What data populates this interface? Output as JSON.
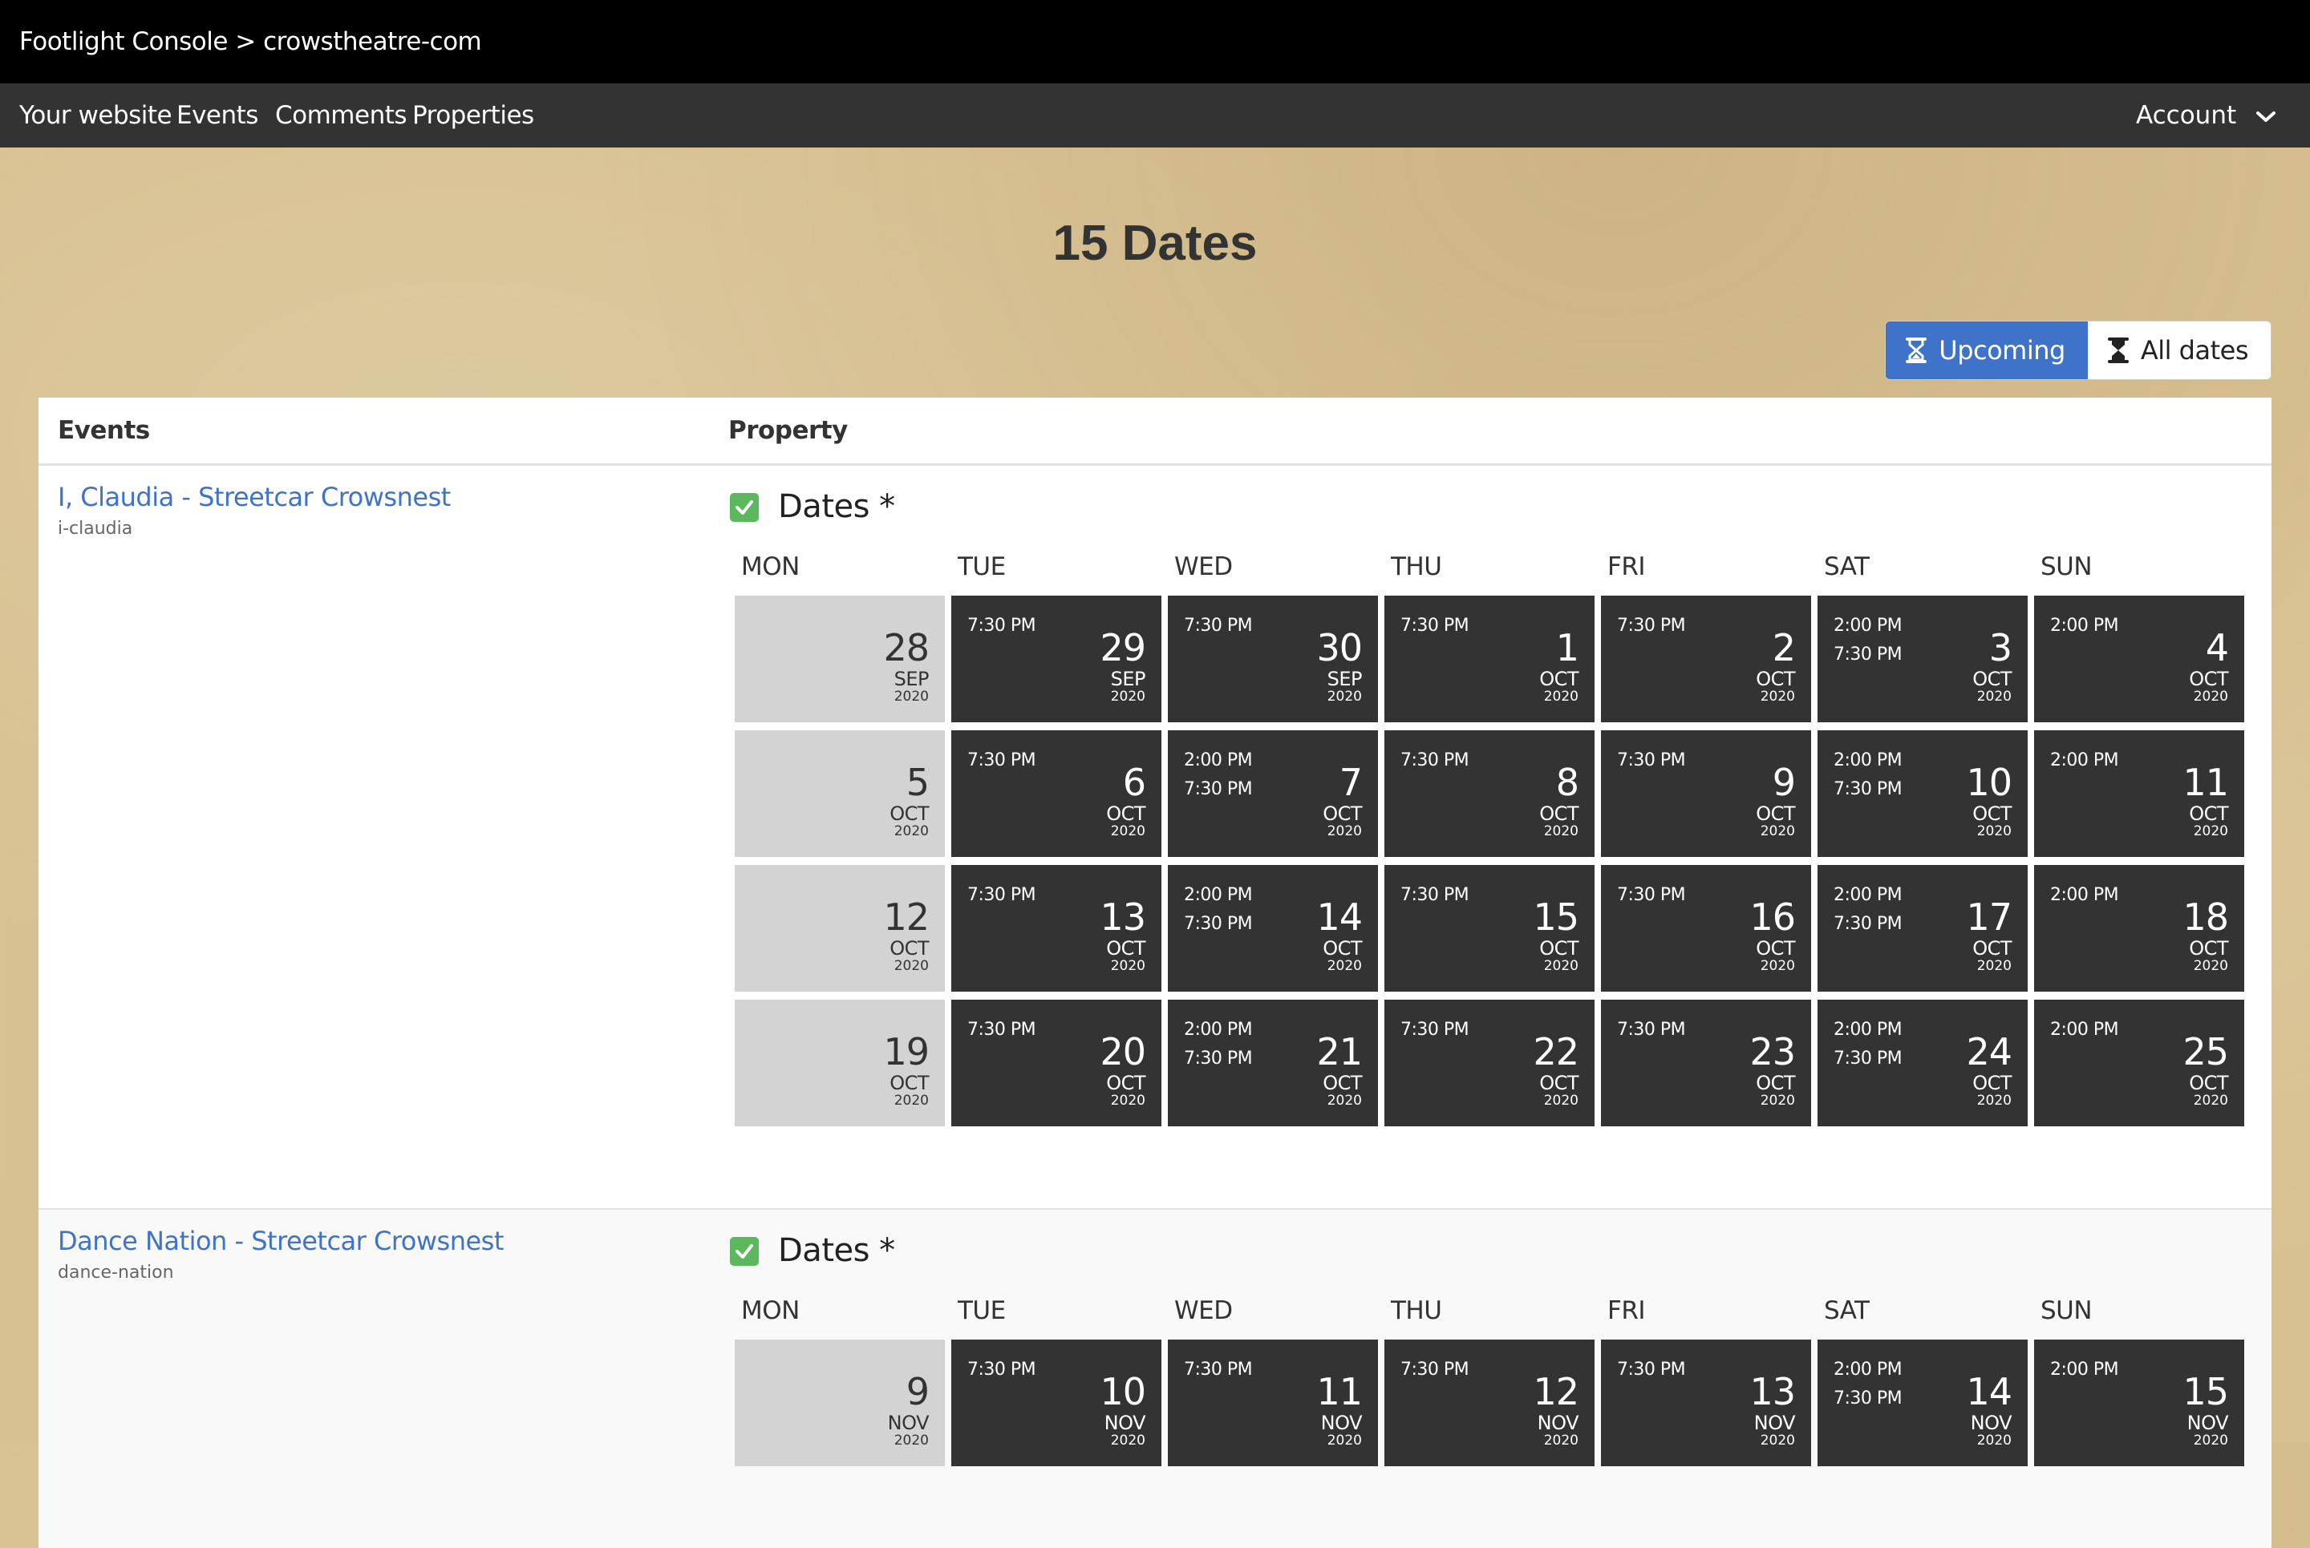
{
  "header": {
    "breadcrumb": "Footlight Console > crowstheatre-com"
  },
  "nav": {
    "items": [
      {
        "label": "Your website"
      },
      {
        "label": "Events"
      },
      {
        "label": "Comments"
      },
      {
        "label": "Properties"
      }
    ],
    "account_label": "Account"
  },
  "page": {
    "title": "15 Dates"
  },
  "filters": {
    "upcoming_label": "Upcoming",
    "all_label": "All dates",
    "active": "upcoming"
  },
  "table": {
    "col_events": "Events",
    "col_property": "Property"
  },
  "weekdays": [
    "MON",
    "TUE",
    "WED",
    "THU",
    "FRI",
    "SAT",
    "SUN"
  ],
  "colors": {
    "accent": "#3f73c9",
    "cell_dark": "#333333",
    "cell_empty": "#d3d3d3",
    "check": "#5cb85c"
  },
  "events": [
    {
      "name": "I, Claudia - Streetcar Crowsnest",
      "slug": "i-claudia",
      "property_label": "Dates *",
      "weeks": [
        [
          {
            "day": "28",
            "month": "SEP",
            "year": "2020",
            "times": [],
            "empty": true
          },
          {
            "day": "29",
            "month": "SEP",
            "year": "2020",
            "times": [
              "7:30 PM"
            ]
          },
          {
            "day": "30",
            "month": "SEP",
            "year": "2020",
            "times": [
              "7:30 PM"
            ]
          },
          {
            "day": "1",
            "month": "OCT",
            "year": "2020",
            "times": [
              "7:30 PM"
            ]
          },
          {
            "day": "2",
            "month": "OCT",
            "year": "2020",
            "times": [
              "7:30 PM"
            ]
          },
          {
            "day": "3",
            "month": "OCT",
            "year": "2020",
            "times": [
              "2:00 PM",
              "7:30 PM"
            ]
          },
          {
            "day": "4",
            "month": "OCT",
            "year": "2020",
            "times": [
              "2:00 PM"
            ]
          }
        ],
        [
          {
            "day": "5",
            "month": "OCT",
            "year": "2020",
            "times": [],
            "empty": true
          },
          {
            "day": "6",
            "month": "OCT",
            "year": "2020",
            "times": [
              "7:30 PM"
            ]
          },
          {
            "day": "7",
            "month": "OCT",
            "year": "2020",
            "times": [
              "2:00 PM",
              "7:30 PM"
            ]
          },
          {
            "day": "8",
            "month": "OCT",
            "year": "2020",
            "times": [
              "7:30 PM"
            ]
          },
          {
            "day": "9",
            "month": "OCT",
            "year": "2020",
            "times": [
              "7:30 PM"
            ]
          },
          {
            "day": "10",
            "month": "OCT",
            "year": "2020",
            "times": [
              "2:00 PM",
              "7:30 PM"
            ]
          },
          {
            "day": "11",
            "month": "OCT",
            "year": "2020",
            "times": [
              "2:00 PM"
            ]
          }
        ],
        [
          {
            "day": "12",
            "month": "OCT",
            "year": "2020",
            "times": [],
            "empty": true
          },
          {
            "day": "13",
            "month": "OCT",
            "year": "2020",
            "times": [
              "7:30 PM"
            ]
          },
          {
            "day": "14",
            "month": "OCT",
            "year": "2020",
            "times": [
              "2:00 PM",
              "7:30 PM"
            ]
          },
          {
            "day": "15",
            "month": "OCT",
            "year": "2020",
            "times": [
              "7:30 PM"
            ]
          },
          {
            "day": "16",
            "month": "OCT",
            "year": "2020",
            "times": [
              "7:30 PM"
            ]
          },
          {
            "day": "17",
            "month": "OCT",
            "year": "2020",
            "times": [
              "2:00 PM",
              "7:30 PM"
            ]
          },
          {
            "day": "18",
            "month": "OCT",
            "year": "2020",
            "times": [
              "2:00 PM"
            ]
          }
        ],
        [
          {
            "day": "19",
            "month": "OCT",
            "year": "2020",
            "times": [],
            "empty": true
          },
          {
            "day": "20",
            "month": "OCT",
            "year": "2020",
            "times": [
              "7:30 PM"
            ]
          },
          {
            "day": "21",
            "month": "OCT",
            "year": "2020",
            "times": [
              "2:00 PM",
              "7:30 PM"
            ]
          },
          {
            "day": "22",
            "month": "OCT",
            "year": "2020",
            "times": [
              "7:30 PM"
            ]
          },
          {
            "day": "23",
            "month": "OCT",
            "year": "2020",
            "times": [
              "7:30 PM"
            ]
          },
          {
            "day": "24",
            "month": "OCT",
            "year": "2020",
            "times": [
              "2:00 PM",
              "7:30 PM"
            ]
          },
          {
            "day": "25",
            "month": "OCT",
            "year": "2020",
            "times": [
              "2:00 PM"
            ]
          }
        ]
      ]
    },
    {
      "name": "Dance Nation - Streetcar Crowsnest",
      "slug": "dance-nation",
      "property_label": "Dates *",
      "weeks": [
        [
          {
            "day": "9",
            "month": "NOV",
            "year": "2020",
            "times": [],
            "empty": true
          },
          {
            "day": "10",
            "month": "NOV",
            "year": "2020",
            "times": [
              "7:30 PM"
            ]
          },
          {
            "day": "11",
            "month": "NOV",
            "year": "2020",
            "times": [
              "7:30 PM"
            ]
          },
          {
            "day": "12",
            "month": "NOV",
            "year": "2020",
            "times": [
              "7:30 PM"
            ]
          },
          {
            "day": "13",
            "month": "NOV",
            "year": "2020",
            "times": [
              "7:30 PM"
            ]
          },
          {
            "day": "14",
            "month": "NOV",
            "year": "2020",
            "times": [
              "2:00 PM",
              "7:30 PM"
            ]
          },
          {
            "day": "15",
            "month": "NOV",
            "year": "2020",
            "times": [
              "2:00 PM"
            ]
          }
        ]
      ]
    }
  ]
}
